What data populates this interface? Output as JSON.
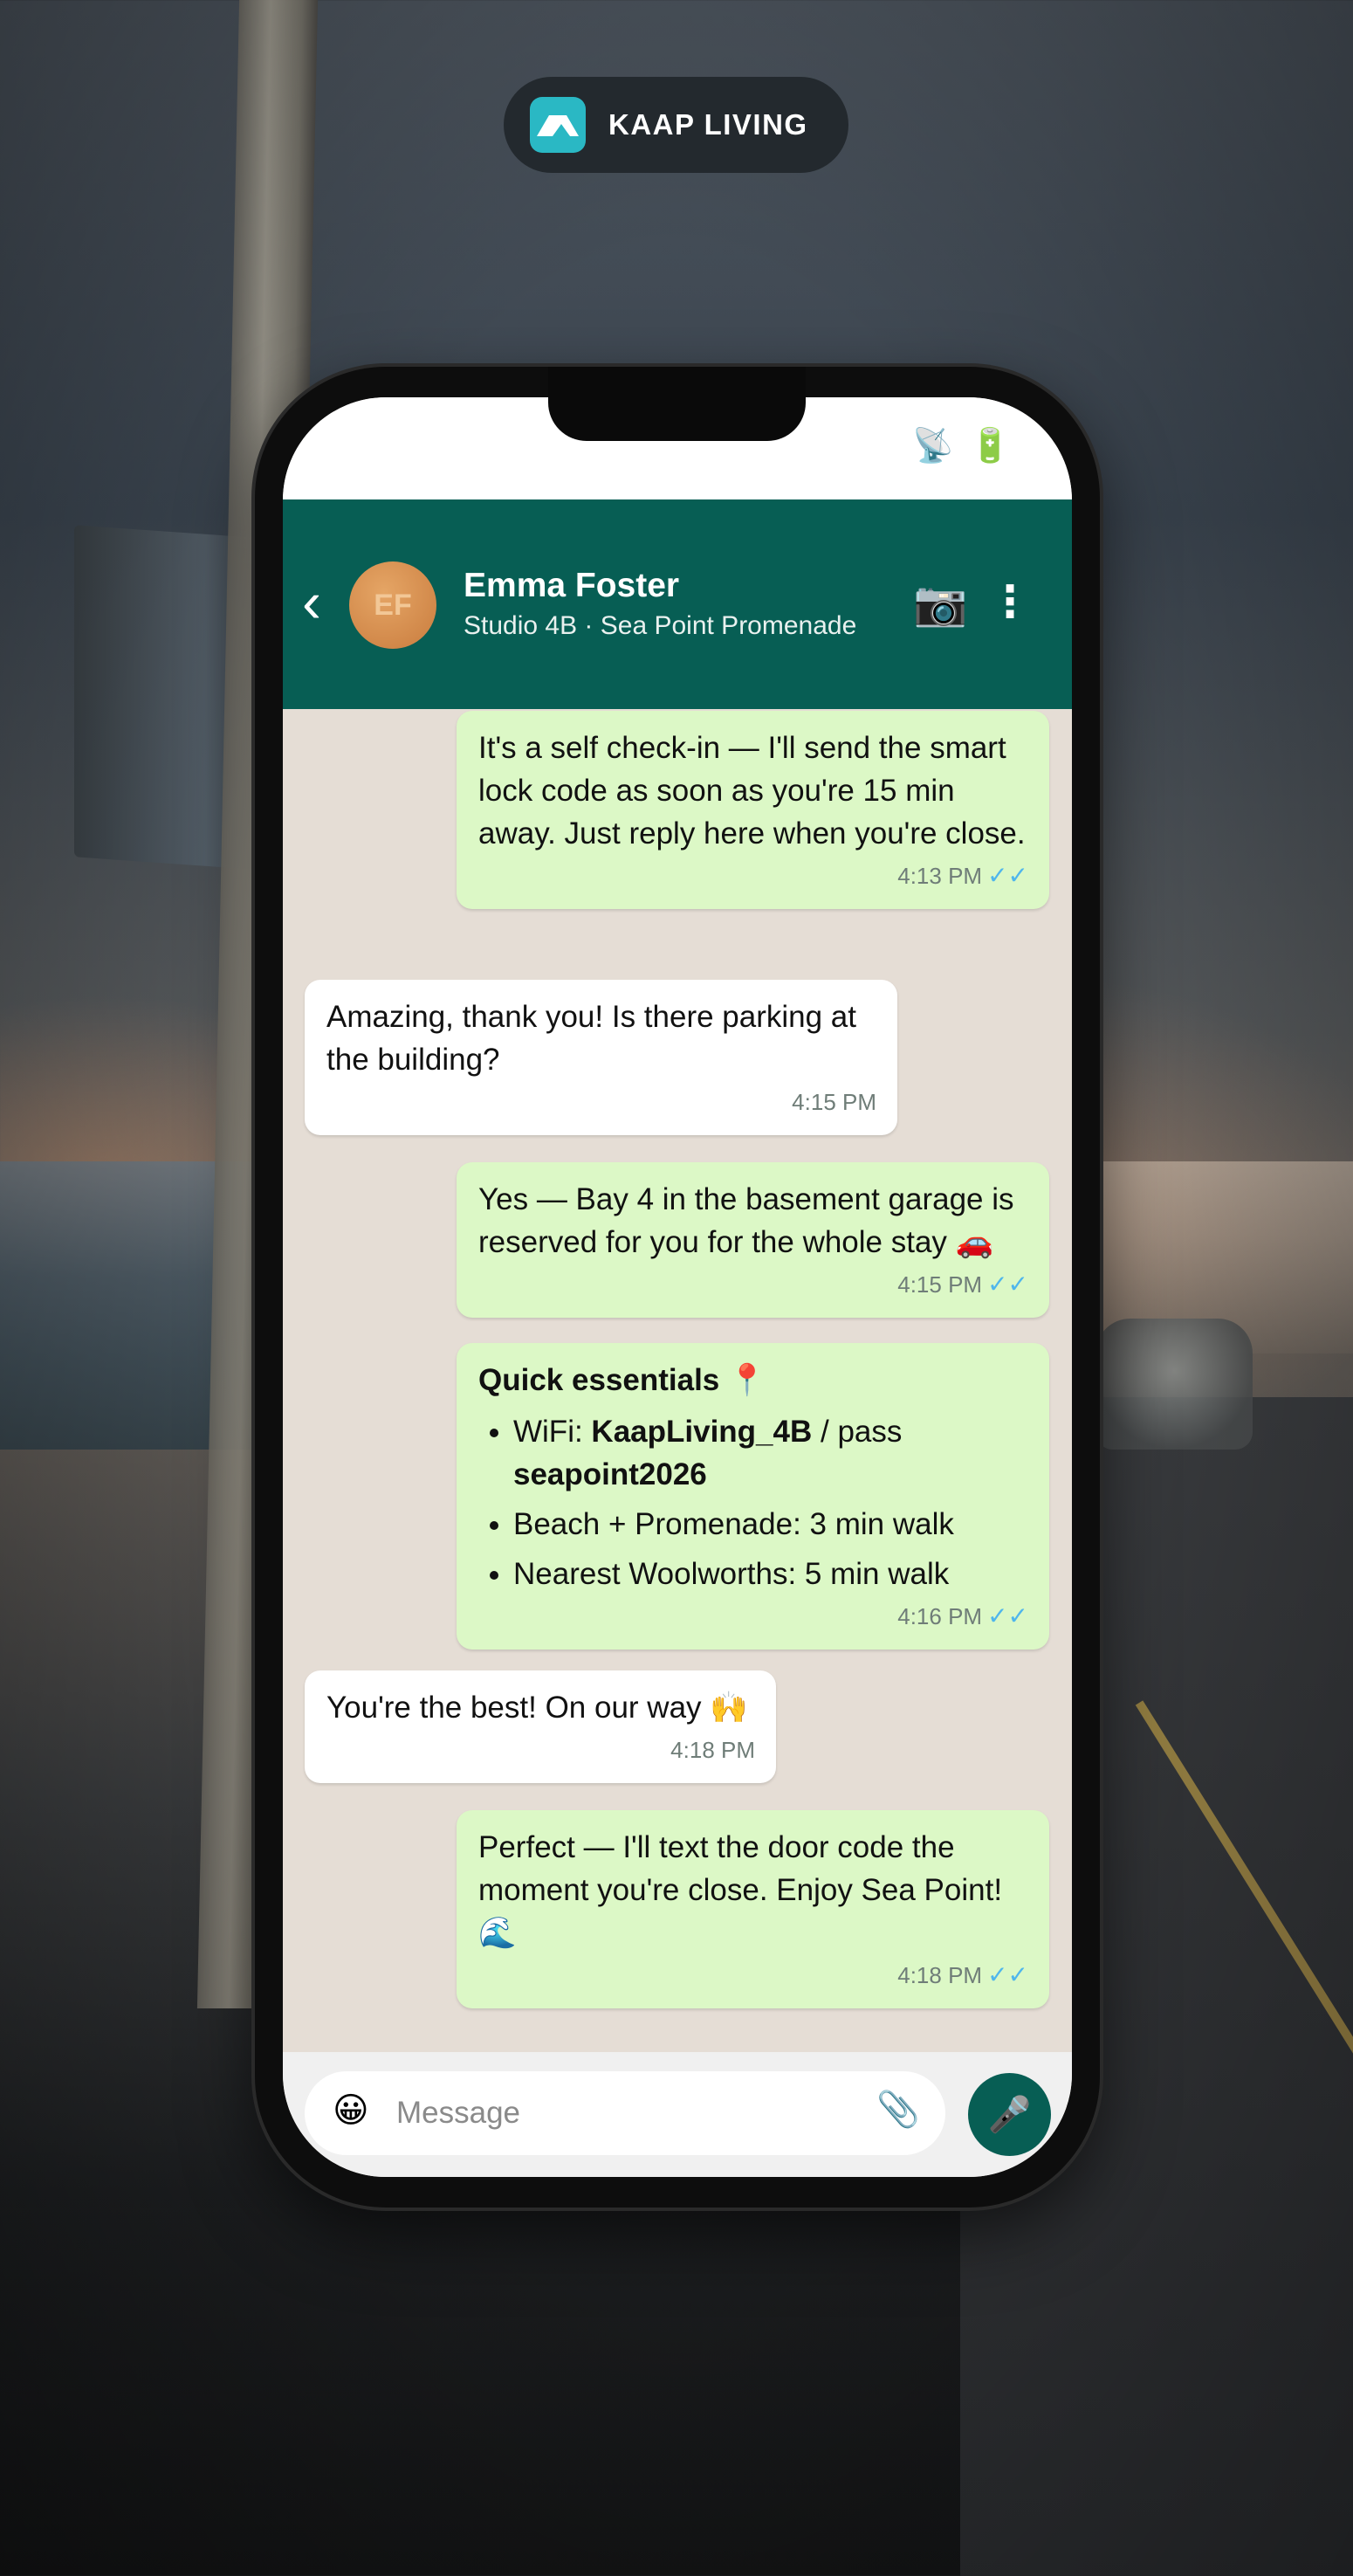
{
  "brand": {
    "name": "KAAP LIVING",
    "color": "#2ab8c4"
  },
  "status_bar": {
    "icons": [
      "satellite-icon",
      "battery-icon"
    ]
  },
  "header": {
    "back_label": "‹",
    "avatar_initials": "EF",
    "contact_name": "Emma Foster",
    "contact_subtitle": "Studio 4B · Sea Point Promenade",
    "icons": [
      "camera-icon",
      "more-vertical-icon"
    ],
    "color": "#075e54"
  },
  "messages": [
    {
      "direction": "out",
      "text": "It's a self check-in — I'll send the smart lock code as soon as you're 15 min away. Just reply here when you're close.",
      "time": "4:13 PM",
      "ticks": "✓✓"
    },
    {
      "direction": "in",
      "text": "Amazing, thank you! Is there parking at the building?",
      "time": "4:15 PM"
    },
    {
      "direction": "out",
      "text": "Yes — Bay 4 in the basement garage is reserved for you for the whole stay 🚗",
      "time": "4:15 PM",
      "ticks": "✓✓"
    },
    {
      "direction": "out",
      "title": "Quick essentials 📍",
      "list": {
        "wifi_prefix": "WiFi: ",
        "wifi_name": "KaapLiving_4B",
        "wifi_mid": " / pass ",
        "wifi_pass": "seapoint2026",
        "item2": "Beach + Promenade: 3 min walk",
        "item3": "Nearest Woolworths: 5 min walk"
      },
      "time": "4:16 PM",
      "ticks": "✓✓"
    },
    {
      "direction": "in",
      "text": "You're the best! On our way 🙌",
      "time": "4:18 PM"
    },
    {
      "direction": "out",
      "text": "Perfect — I'll text the door code the moment you're close. Enjoy Sea Point! 🌊",
      "time": "4:18 PM",
      "ticks": "✓✓"
    }
  ],
  "input": {
    "placeholder": "Message",
    "emoji_glyph": "😀",
    "attach_glyph": "📎",
    "mic_glyph": "🎤"
  },
  "colors": {
    "outgoing_bubble": "#dcf8c6",
    "incoming_bubble": "#ffffff",
    "chat_bg": "#e5ddd5",
    "read_ticks": "#4fb6ec"
  }
}
